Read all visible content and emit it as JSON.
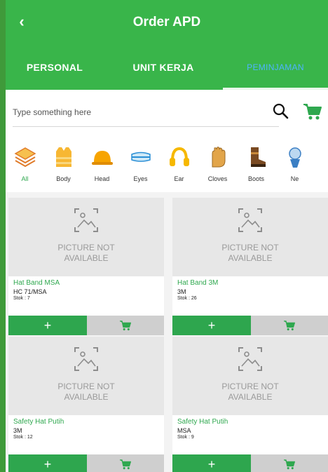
{
  "header": {
    "title": "Order APD",
    "back_icon": "chevron-left-icon"
  },
  "tabs": [
    {
      "label": "PERSONAL",
      "active": false
    },
    {
      "label": "UNIT KERJA",
      "active": false
    },
    {
      "label": "PEMINJAMAN",
      "active": true
    }
  ],
  "search": {
    "placeholder": "Type something here",
    "value": "",
    "search_icon": "search-icon",
    "cart_icon": "cart-icon"
  },
  "categories": [
    {
      "label": "All",
      "icon": "layers-icon",
      "active": true
    },
    {
      "label": "Body",
      "icon": "vest-icon",
      "active": false
    },
    {
      "label": "Head",
      "icon": "hard-hat-icon",
      "active": false
    },
    {
      "label": "Eyes",
      "icon": "goggles-icon",
      "active": false
    },
    {
      "label": "Ear",
      "icon": "ear-muff-icon",
      "active": false
    },
    {
      "label": "Cloves",
      "icon": "glove-icon",
      "active": false
    },
    {
      "label": "Boots",
      "icon": "boot-icon",
      "active": false
    },
    {
      "label": "Ne",
      "icon": "neck-icon",
      "active": false
    }
  ],
  "products": [
    {
      "placeholder": "PICTURE NOT AVAILABLE",
      "name": "Hat Band MSA",
      "code": "HC 71/MSA",
      "stok": "Stok : 7",
      "add_label": "+"
    },
    {
      "placeholder": "PICTURE NOT AVAILABLE",
      "name": "Hat Band 3M",
      "code": "3M",
      "stok": "Stok : 26",
      "add_label": "+"
    },
    {
      "placeholder": "PICTURE NOT AVAILABLE",
      "name": "Safety Hat Putih",
      "code": "3M",
      "stok": "Stok : 12",
      "add_label": "+"
    },
    {
      "placeholder": "PICTURE NOT AVAILABLE",
      "name": "Safety Hat Putih",
      "code": "MSA",
      "stok": "Stok : 9",
      "add_label": "+"
    }
  ],
  "colors": {
    "primary_green": "#39b54a",
    "button_green": "#2ea64e",
    "active_tab_text": "#4fb3ff"
  }
}
